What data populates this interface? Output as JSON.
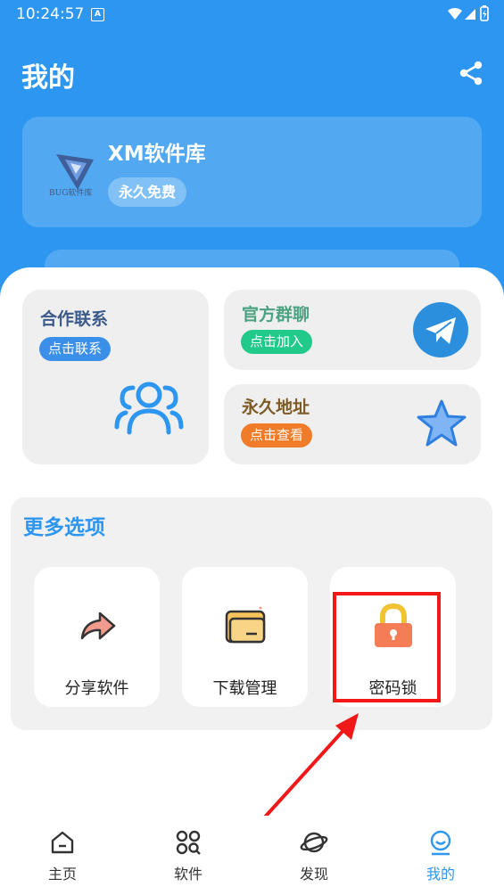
{
  "status_bar": {
    "time": "10:24:57",
    "notification": "A"
  },
  "header": {
    "title": "我的"
  },
  "profile": {
    "name": "XM软件库",
    "badge": "永久免费",
    "avatar_caption": "BUG软件库"
  },
  "quick_cards": {
    "cooperation": {
      "title": "合作联系",
      "action": "点击联系",
      "title_color": "#3b5b8a",
      "pill_color": "#3a8fe8"
    },
    "official_group": {
      "title": "官方群聊",
      "action": "点击加入",
      "title_color": "#4aa283",
      "pill_color": "#21c98b"
    },
    "permanent_address": {
      "title": "永久地址",
      "action": "点击查看",
      "title_color": "#7d5a26",
      "pill_color": "#f07b28"
    }
  },
  "more_options": {
    "title": "更多选项",
    "items": [
      {
        "label": "分享软件",
        "icon": "share-arrow-icon"
      },
      {
        "label": "下载管理",
        "icon": "folder-icon"
      },
      {
        "label": "密码锁",
        "icon": "padlock-icon"
      }
    ]
  },
  "bottom_nav": {
    "items": [
      {
        "label": "主页",
        "icon": "home-icon"
      },
      {
        "label": "软件",
        "icon": "apps-grid-icon"
      },
      {
        "label": "发现",
        "icon": "planet-icon"
      },
      {
        "label": "我的",
        "icon": "smiley-icon",
        "active": true
      }
    ]
  },
  "colors": {
    "brand_blue": "#2d96f0",
    "highlight_red": "#f01818"
  }
}
